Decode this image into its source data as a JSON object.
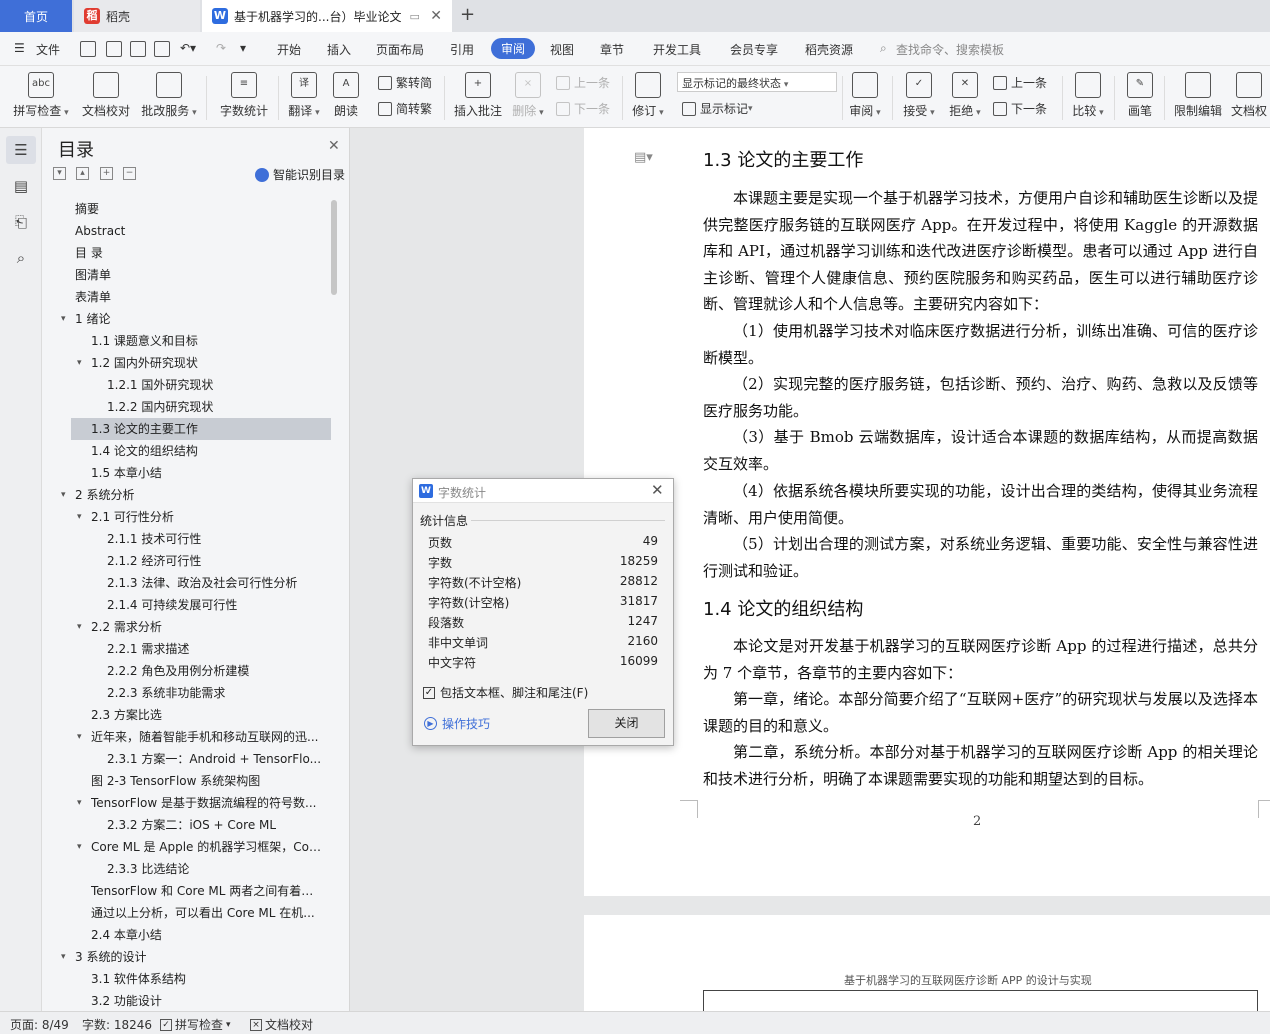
{
  "tabs": {
    "home": "首页",
    "daoke": "稻壳",
    "doc": "基于机器学习的...台）毕业论文"
  },
  "menu": {
    "file": "文件",
    "items": [
      "开始",
      "插入",
      "页面布局",
      "引用",
      "审阅",
      "视图",
      "章节",
      "开发工具",
      "会员专享",
      "稻壳资源"
    ],
    "active": "审阅",
    "search": "查找命令、搜索模板"
  },
  "ribbon": {
    "spell": "拼写检查",
    "doccheck": "文档校对",
    "review_service": "批改服务",
    "wordcount": "字数统计",
    "translate": "翻译",
    "read": "朗读",
    "trad": "繁转简",
    "simp": "简转繁",
    "insert_comment": "插入批注",
    "delete": "删除",
    "prev_comment": "上一条",
    "next_comment": "下一条",
    "track": "修订",
    "markup_state": "显示标记的最终状态",
    "show_markup": "显示标记",
    "review": "审阅",
    "accept": "接受",
    "reject": "拒绝",
    "prev": "上一条",
    "next": "下一条",
    "compare": "比较",
    "pen": "画笔",
    "restrict": "限制编辑",
    "doc_perm": "文档权"
  },
  "toc": {
    "title": "目录",
    "smart": "智能识别目录",
    "items": [
      {
        "text": "摘要",
        "level": 0,
        "arrow": false
      },
      {
        "text": "Abstract",
        "level": 0,
        "arrow": false
      },
      {
        "text": "目  录",
        "level": 0,
        "arrow": false
      },
      {
        "text": "图清单",
        "level": 0,
        "arrow": false
      },
      {
        "text": "表清单",
        "level": 0,
        "arrow": false
      },
      {
        "text": "1  绪论",
        "level": 0,
        "arrow": true
      },
      {
        "text": "1.1  课题意义和目标",
        "level": 1,
        "arrow": false
      },
      {
        "text": "1.2  国内外研究现状",
        "level": 1,
        "arrow": true
      },
      {
        "text": "1.2.1  国外研究现状",
        "level": 2,
        "arrow": false
      },
      {
        "text": "1.2.2  国内研究现状",
        "level": 2,
        "arrow": false
      },
      {
        "text": "1.3  论文的主要工作",
        "level": 1,
        "arrow": false,
        "selected": true
      },
      {
        "text": "1.4  论文的组织结构",
        "level": 1,
        "arrow": false
      },
      {
        "text": "1.5  本章小结",
        "level": 1,
        "arrow": false
      },
      {
        "text": "2  系统分析",
        "level": 0,
        "arrow": true
      },
      {
        "text": "2.1  可行性分析",
        "level": 1,
        "arrow": true
      },
      {
        "text": "2.1.1  技术可行性",
        "level": 2,
        "arrow": false
      },
      {
        "text": "2.1.2  经济可行性",
        "level": 2,
        "arrow": false
      },
      {
        "text": "2.1.3  法律、政治及社会可行性分析",
        "level": 2,
        "arrow": false
      },
      {
        "text": "2.1.4  可持续发展可行性",
        "level": 2,
        "arrow": false
      },
      {
        "text": "2.2  需求分析",
        "level": 1,
        "arrow": true
      },
      {
        "text": "2.2.1  需求描述",
        "level": 2,
        "arrow": false
      },
      {
        "text": "2.2.2  角色及用例分析建模",
        "level": 2,
        "arrow": false
      },
      {
        "text": "2.2.3  系统非功能需求",
        "level": 2,
        "arrow": false
      },
      {
        "text": "2.3  方案比选",
        "level": 1,
        "arrow": false
      },
      {
        "text": "近年来，随着智能手机和移动互联网的迅...",
        "level": 1,
        "arrow": true
      },
      {
        "text": "2.3.1  方案一：Android + TensorFlo...",
        "level": 2,
        "arrow": false
      },
      {
        "text": "图 2-3 TensorFlow 系统架构图",
        "level": 1,
        "arrow": false
      },
      {
        "text": "TensorFlow 是基于数据流编程的符号数...",
        "level": 1,
        "arrow": true
      },
      {
        "text": "2.3.2  方案二：iOS + Core ML",
        "level": 2,
        "arrow": false
      },
      {
        "text": "Core ML 是 Apple 的机器学习框架，Cor...",
        "level": 1,
        "arrow": true
      },
      {
        "text": "2.3.3  比选结论",
        "level": 2,
        "arrow": false
      },
      {
        "text": "TensorFlow 和 Core ML 两者之间有着很...",
        "level": 1,
        "arrow": false
      },
      {
        "text": "通过以上分析，可以看出 Core ML 在机...",
        "level": 1,
        "arrow": false
      },
      {
        "text": "2.4  本章小结",
        "level": 1,
        "arrow": false
      },
      {
        "text": "3  系统的设计",
        "level": 0,
        "arrow": true
      },
      {
        "text": "3.1  软件体系结构",
        "level": 1,
        "arrow": false
      },
      {
        "text": "3.2  功能设计",
        "level": 1,
        "arrow": false
      }
    ]
  },
  "doc": {
    "h13": "1.3  论文的主要工作",
    "p1": "本课题主要是实现一个基于机器学习技术，方便用户自诊和辅助医生诊断以及提供完整医疗服务链的互联网医疗 App。在开发过程中，将使用 Kaggle 的开源数据库和 API，通过机器学习训练和迭代改进医疗诊断模型。患者可以通过 App 进行自主诊断、管理个人健康信息、预约医院服务和购买药品，医生可以进行辅助医疗诊断、管理就诊人和个人信息等。主要研究内容如下：",
    "p2": "（1）使用机器学习技术对临床医疗数据进行分析，训练出准确、可信的医疗诊断模型。",
    "p3": "（2）实现完整的医疗服务链，包括诊断、预约、治疗、购药、急救以及反馈等医疗服务功能。",
    "p4": "（3）基于 Bmob 云端数据库，设计适合本课题的数据库结构，从而提高数据交互效率。",
    "p5": "（4）依据系统各模块所要实现的功能，设计出合理的类结构，使得其业务流程清晰、用户使用简便。",
    "p6": "（5）计划出合理的测试方案，对系统业务逻辑、重要功能、安全性与兼容性进行测试和验证。",
    "h14": "1.4  论文的组织结构",
    "p7": "本论文是对开发基于机器学习的互联网医疗诊断 App 的过程进行描述，总共分为 7 个章节，各章节的主要内容如下：",
    "p8": "第一章，绪论。本部分简要介绍了“互联网+医疗”的研究现状与发展以及选择本课题的目的和意义。",
    "p9": "第二章，系统分析。本部分对基于机器学习的互联网医疗诊断 App 的相关理论和技术进行分析，明确了本课题需要实现的功能和期望达到的目标。",
    "page_number": "2",
    "page2_header": "基于机器学习的互联网医疗诊断 APP 的设计与实现"
  },
  "wordcount": {
    "title": "字数统计",
    "section": "统计信息",
    "rows": [
      {
        "label": "页数",
        "value": "49"
      },
      {
        "label": "字数",
        "value": "18259"
      },
      {
        "label": "字符数(不计空格)",
        "value": "28812"
      },
      {
        "label": "字符数(计空格)",
        "value": "31817"
      },
      {
        "label": "段落数",
        "value": "1247"
      },
      {
        "label": "非中文单词",
        "value": "2160"
      },
      {
        "label": "中文字符",
        "value": "16099"
      }
    ],
    "include": "包括文本框、脚注和尾注(F)",
    "tips": "操作技巧",
    "close": "关闭"
  },
  "status": {
    "page": "页面: 8/49",
    "words": "字数: 18246",
    "spell": "拼写检查",
    "doccheck": "文档校对"
  }
}
